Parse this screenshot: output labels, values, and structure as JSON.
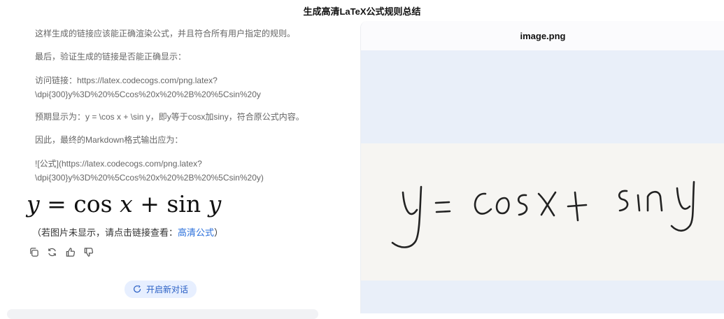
{
  "window": {
    "title": "生成高清LaTeX公式规则总结"
  },
  "chat": {
    "paragraphs": [
      "这样生成的链接应该能正确渲染公式，并且符合所有用户指定的规则。",
      "最后，验证生成的链接是否能正确显示：",
      "访问链接：https://latex.codecogs.com/png.latex?\\dpi{300}y%3D%20%5Ccos%20x%20%2B%20%5Csin%20y",
      "预期显示为：y = \\cos x + \\sin y，即y等于cosx加siny，符合原公式内容。",
      "因此，最终的Markdown格式输出应为：",
      "![公式](https://latex.codecogs.com/png.latex?\\dpi{300}y%3D%20%5Ccos%20x%20%2B%20%5Csin%20y)"
    ],
    "formula": {
      "y": "y",
      "eq": " = ",
      "cos": "cos ",
      "x": "x",
      "plus": " + ",
      "sin": "sin ",
      "y2": "y"
    },
    "note_prefix": "（若图片未显示，请点击链接查看：",
    "note_link": "高清公式",
    "note_suffix": "）",
    "actions": [
      "copy-icon",
      "refresh-icon",
      "thumbs-up-icon",
      "thumbs-down-icon"
    ],
    "new_chat_label": "开启新对话"
  },
  "preview": {
    "filename": "image.png",
    "handwriting_text": "y = cos x + sin y"
  }
}
